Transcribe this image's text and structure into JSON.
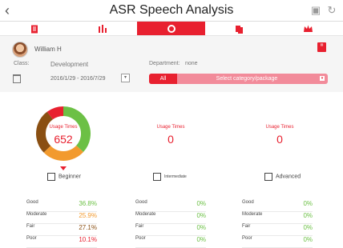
{
  "app": {
    "title": "ASR Speech Analysis",
    "back_icon": "chevron-left-icon",
    "top_icons": [
      "share-icon",
      "refresh-icon"
    ]
  },
  "tabs": [
    {
      "name": "document-tab",
      "icon": "document-icon",
      "active": false
    },
    {
      "name": "bar-chart-tab",
      "icon": "bar-chart-icon",
      "active": false
    },
    {
      "name": "donut-tab",
      "icon": "donut-icon",
      "active": true
    },
    {
      "name": "copy-tab",
      "icon": "copy-icon",
      "active": false
    },
    {
      "name": "crown-tab",
      "icon": "crown-icon",
      "active": false
    }
  ],
  "filter": {
    "user_name": "William H",
    "class_label": "Class:",
    "class_value": "Development",
    "department_label": "Department:",
    "department_value": "none",
    "date_range": "2016/1/29 - 2016/7/29",
    "category_all": "All",
    "category_placeholder": "Select category/package"
  },
  "panels": [
    {
      "usage_label": "Usage Times",
      "usage_value": "652",
      "level": "Beginner",
      "stats": [
        {
          "label": "Good",
          "value": "36.8%",
          "color": "#6cc045"
        },
        {
          "label": "Moderate",
          "value": "25.9%",
          "color": "#f29a2e"
        },
        {
          "label": "Fair",
          "value": "27.1%",
          "color": "#8a4f12"
        },
        {
          "label": "Poor",
          "value": "10.1%",
          "color": "#e8202f"
        }
      ],
      "chart_data": {
        "type": "pie",
        "categories": [
          "Good",
          "Moderate",
          "Fair",
          "Poor"
        ],
        "values": [
          36.8,
          25.9,
          27.1,
          10.1
        ],
        "colors": [
          "#6cc045",
          "#f29a2e",
          "#8a4f12",
          "#e8202f"
        ]
      }
    },
    {
      "usage_label": "Usage Times",
      "usage_value": "0",
      "level": "Intermediate",
      "stats": [
        {
          "label": "Good",
          "value": "0%",
          "color": "#6cc045"
        },
        {
          "label": "Moderate",
          "value": "0%",
          "color": "#6cc045"
        },
        {
          "label": "Fair",
          "value": "0%",
          "color": "#6cc045"
        },
        {
          "label": "Poor",
          "value": "0%",
          "color": "#6cc045"
        }
      ]
    },
    {
      "usage_label": "Usage Times",
      "usage_value": "0",
      "level": "Advanced",
      "stats": [
        {
          "label": "Good",
          "value": "0%",
          "color": "#6cc045"
        },
        {
          "label": "Moderate",
          "value": "0%",
          "color": "#6cc045"
        },
        {
          "label": "Fair",
          "value": "0%",
          "color": "#6cc045"
        },
        {
          "label": "Poor",
          "value": "0%",
          "color": "#6cc045"
        }
      ]
    }
  ]
}
